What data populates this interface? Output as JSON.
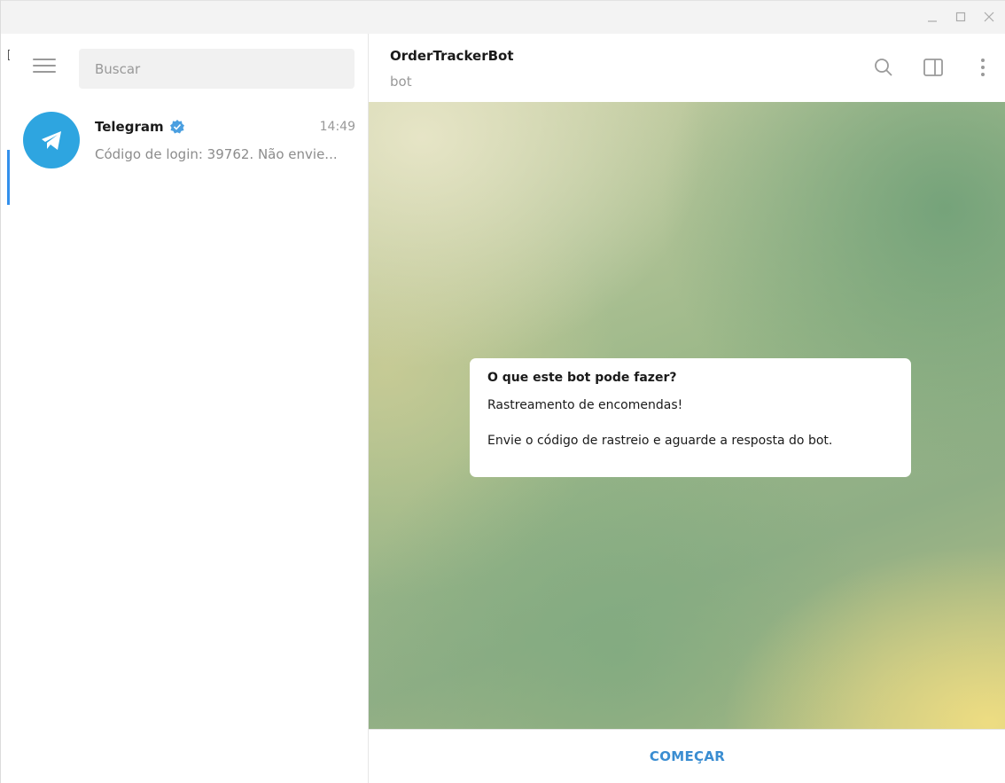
{
  "window": {
    "controls": [
      "minimize-icon",
      "maximize-icon",
      "close-icon"
    ]
  },
  "sidebar": {
    "menu_icon": "hamburger-menu-icon",
    "search": {
      "placeholder": "Buscar",
      "value": ""
    },
    "chats": [
      {
        "name": "Telegram",
        "verified": true,
        "time": "14:49",
        "preview": "Código de login: 39762. Não envie...",
        "avatar_icon": "telegram-plane-icon",
        "avatar_color": "#2ea5e0"
      }
    ]
  },
  "chat": {
    "title": "OrderTrackerBot",
    "subtitle": "bot",
    "header_icons": [
      "search-icon",
      "sidebar-toggle-icon",
      "more-vertical-icon"
    ],
    "bot_info": {
      "title": "O que este bot pode fazer?",
      "line1": "Rastreamento de encomendas!",
      "line2": "Envie o código de rastreio e aguarde a resposta do bot."
    },
    "start_label": "COMEÇAR"
  },
  "colors": {
    "accent": "#3390ec",
    "start_button": "#3a8dd1",
    "verified_badge": "#4a9fe0"
  }
}
